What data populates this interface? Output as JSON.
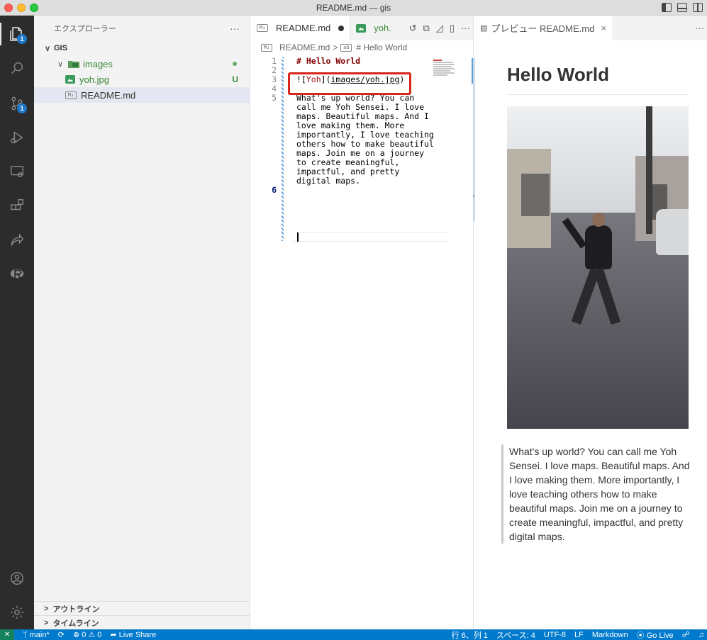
{
  "window": {
    "title": "README.md — gis"
  },
  "activity_bar": {
    "explorer_badge": "1",
    "scm_badge": "1"
  },
  "sidebar": {
    "title": "エクスプローラー",
    "more": "···",
    "root": "GIS",
    "items": [
      {
        "label": "images",
        "status": ""
      },
      {
        "label": "yoh.jpg",
        "status": "U"
      },
      {
        "label": "README.md",
        "status": ""
      }
    ],
    "md_icon_text": "M↓",
    "outline": "アウトライン",
    "timeline": "タイムライン"
  },
  "editor": {
    "tabs": [
      {
        "label": "README.md"
      },
      {
        "label": "yoh."
      }
    ],
    "breadcrumb": {
      "file": "README.md",
      "sep": ">",
      "symbol": "# Hello World"
    },
    "line_numbers": [
      "1",
      "2",
      "3",
      "4",
      "5",
      "",
      "",
      "",
      "",
      "",
      "",
      "",
      "",
      "",
      "6"
    ],
    "lines": {
      "l1": "# Hello World",
      "l3_open": "![",
      "l3_alt": "Yoh",
      "l3_mid": "](",
      "l3_url": "images/yoh.jpg",
      "l3_close": ")",
      "l5": [
        "What's up world? You can",
        "call me Yoh Sensei. I love",
        "maps. Beautiful maps. And I",
        "love making them. More",
        "importantly, I love teaching",
        "others how to make beautiful",
        "maps. Join me on a journey",
        "to create meaningful,",
        "impactful, and pretty",
        "digital maps."
      ]
    }
  },
  "preview": {
    "tab_label": "プレビュー README.md",
    "close": "×",
    "more": "···",
    "heading": "Hello World",
    "paragraph": "What's up world? You can call me Yoh Sensei. I love maps. Beautiful maps. And I love making them. More importantly, I love teaching others how to make beautiful maps. Join me on a journey to create meaningful, impactful, and pretty digital maps."
  },
  "statusbar": {
    "branch": "main*",
    "errors": "⊗ 0",
    "warnings": "⚠ 0",
    "live_share": "Live Share",
    "position": "行 6、列 1",
    "spaces": "スペース: 4",
    "encoding": "UTF-8",
    "eol": "LF",
    "language": "Markdown",
    "go_live": "Go Live"
  },
  "colors": {
    "accent": "#007acc",
    "highlight_box": "#d8261b",
    "git_untracked": "#3a8a3a"
  }
}
